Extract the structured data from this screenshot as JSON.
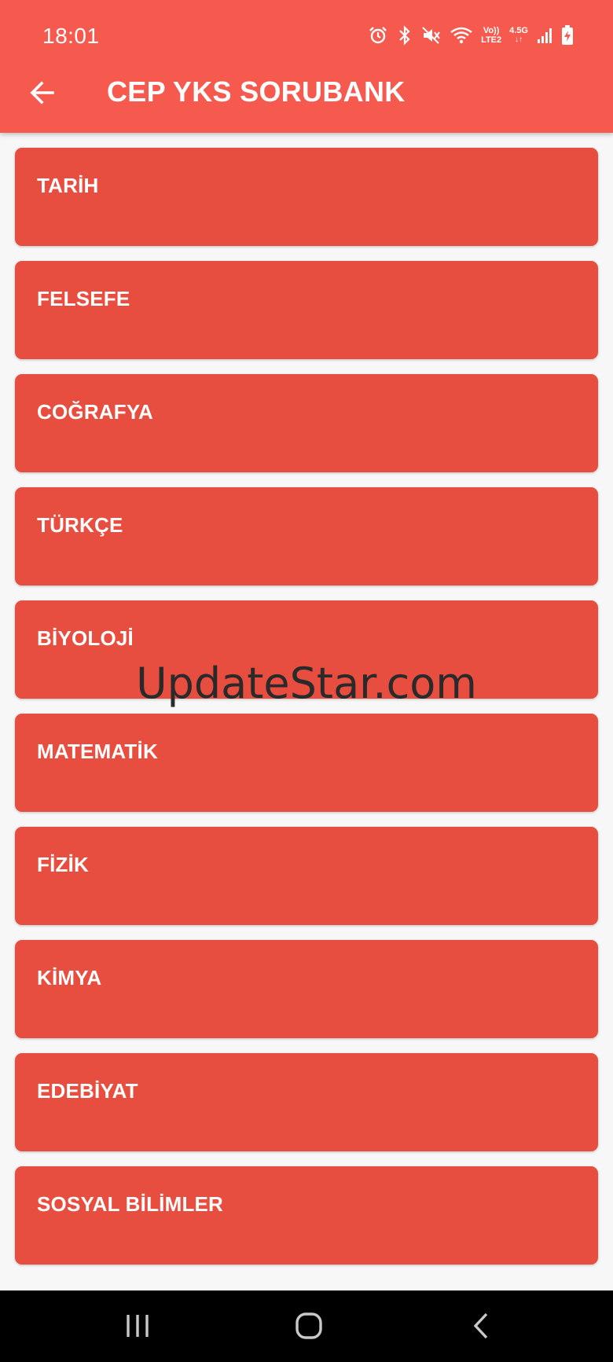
{
  "status_bar": {
    "time": "18:01",
    "icons": [
      "alarm-icon",
      "bluetooth-icon",
      "mute-icon",
      "wifi-icon",
      "volte-lte2-icon",
      "4-5g-icon",
      "signal-icon",
      "battery-charging-icon"
    ],
    "volte_label": "Vo))",
    "lte_label": "LTE2",
    "network_label": "4.5G"
  },
  "app_bar": {
    "title": "CEP YKS SORUBANK",
    "back_icon": "arrow-left-icon",
    "color": "#f65a4f"
  },
  "subjects": [
    {
      "label": "TARİH"
    },
    {
      "label": "FELSEFE"
    },
    {
      "label": "COĞRAFYA"
    },
    {
      "label": "TÜRKÇE"
    },
    {
      "label": "BİYOLOJİ"
    },
    {
      "label": "MATEMATİK"
    },
    {
      "label": "FİZİK"
    },
    {
      "label": "KİMYA"
    },
    {
      "label": "EDEBİYAT"
    },
    {
      "label": "SOSYAL BİLİMLER"
    }
  ],
  "card_color": "#e84e3f",
  "watermark": "UpdateStar.com",
  "nav_bar": {
    "icons": [
      "recents-icon",
      "home-icon",
      "back-icon"
    ]
  }
}
